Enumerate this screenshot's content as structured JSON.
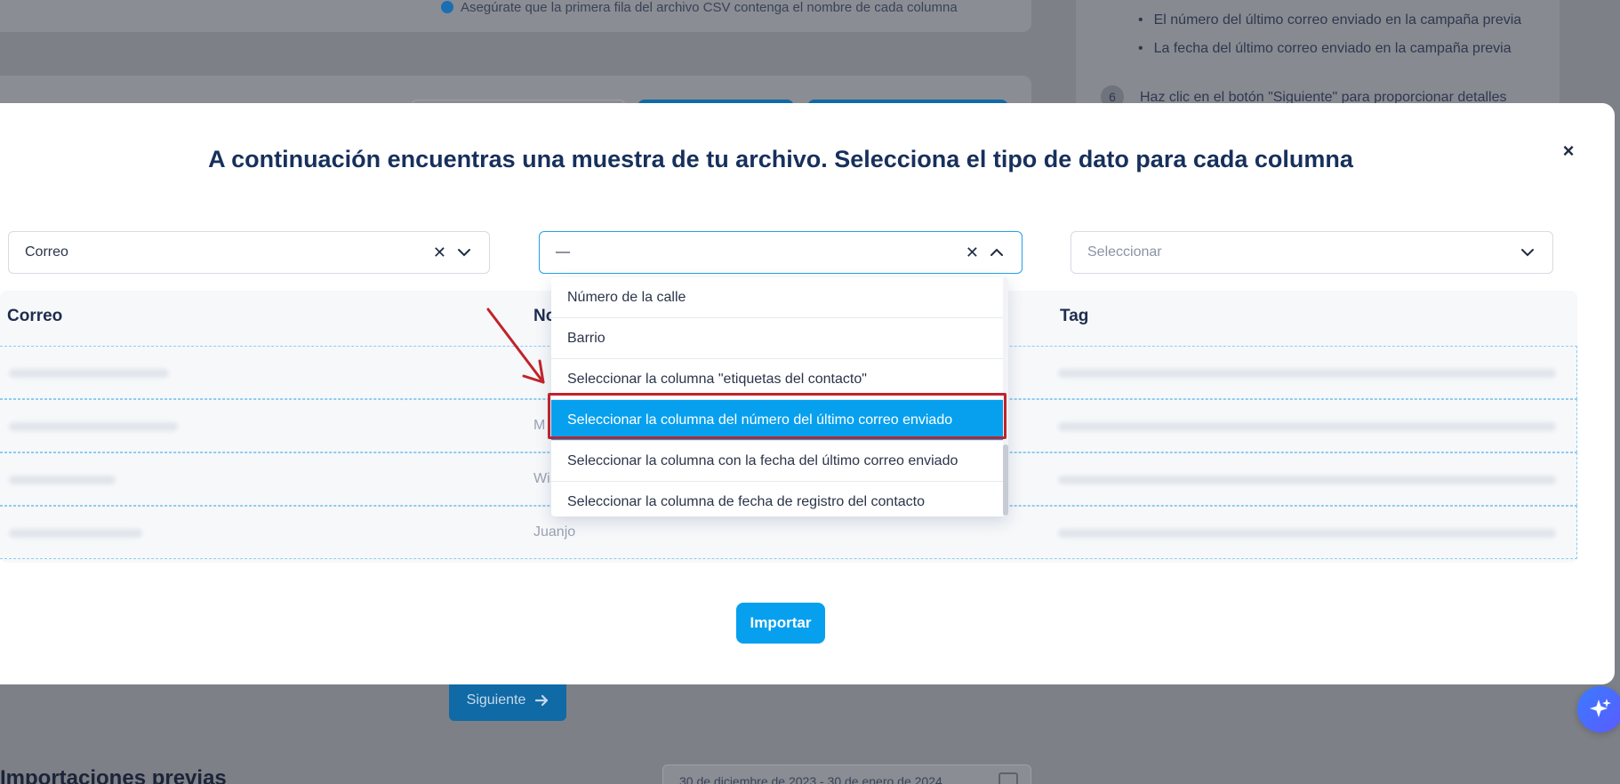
{
  "background": {
    "instructions_tip": "Asegúrate que la primera fila del archivo CSV contenga el nombre de cada columna",
    "bullets": [
      "El número del último correo enviado en la campaña previa",
      "La fecha del último correo enviado en la campaña previa"
    ],
    "step_number": "6",
    "step_text": "Haz clic en el botón \"Siguiente\" para proporcionar detalles",
    "next_button": "Siguiente",
    "previous_imports_heading": "Importaciones previas",
    "date_range": "30 de diciembre de 2023 - 30 de enero de 2024"
  },
  "modal": {
    "title": "A continuación encuentras una muestra de tu archivo. Selecciona el tipo de dato para cada columna",
    "close_icon": "×",
    "selects": [
      {
        "value": "Correo",
        "placeholder": ""
      },
      {
        "value": "—",
        "placeholder": ""
      },
      {
        "value": "",
        "placeholder": "Seleccionar"
      }
    ],
    "columns": [
      "Correo",
      "No",
      "Tag"
    ],
    "rows": [
      {
        "name": ""
      },
      {
        "name": "M"
      },
      {
        "name": "Wi"
      },
      {
        "name": "Juanjo"
      }
    ],
    "dropdown_options": [
      "Número de la calle",
      "Barrio",
      "Seleccionar la columna \"etiquetas del contacto\"",
      "Seleccionar la columna del número del último correo enviado",
      "Seleccionar la columna con la fecha del último correo enviado",
      "Seleccionar la columna de fecha de registro del contacto"
    ],
    "highlighted_option_index": 3,
    "import_button": "Importar"
  },
  "icons": {
    "close": "close-icon",
    "clear": "clear-icon",
    "chevron_down": "chevron-down-icon",
    "chevron_up": "chevron-up-icon",
    "arrow_right": "arrow-right-icon",
    "annotation_arrow": "annotation-arrow",
    "sparkle": "sparkle-icon",
    "calendar": "calendar-icon",
    "info": "info-icon"
  },
  "colors": {
    "accent": "#07a0ee",
    "title": "#17305c",
    "annotation": "#c0232b"
  }
}
